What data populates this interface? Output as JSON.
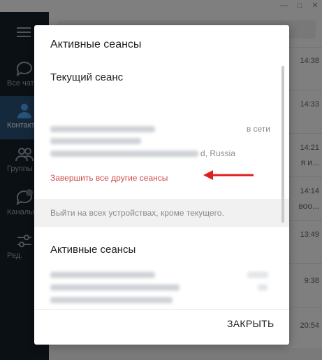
{
  "app": {
    "sidebar": [
      {
        "label": "Все чаты",
        "icon": "chat-bubbles-icon"
      },
      {
        "label": "Контакты",
        "icon": "person-icon"
      },
      {
        "label": "Группы",
        "icon": "group-icon"
      },
      {
        "label": "Каналы",
        "icon": "channel-icon"
      },
      {
        "label": "Ред.",
        "icon": "sliders-icon"
      }
    ],
    "chats": [
      {
        "time": "14:38",
        "snippet": ""
      },
      {
        "time": "14:33",
        "snippet": ""
      },
      {
        "time": "14:21",
        "snippet": "я и..."
      },
      {
        "time": "14:14",
        "snippet": "воо..."
      },
      {
        "time": "13:49",
        "snippet": ""
      },
      {
        "time": "9:38",
        "snippet": ""
      },
      {
        "time": "20:54",
        "snippet": ""
      }
    ]
  },
  "dialog": {
    "title": "Активные сеансы",
    "current": {
      "heading": "Текущий сеанс",
      "status": "в сети",
      "location": "d, Russia",
      "terminate_label": "Завершить все другие сеансы"
    },
    "hint": "Выйти на всех устройствах, кроме текущего.",
    "active_heading": "Активные сеансы",
    "close_label": "ЗАКРЫТЬ"
  },
  "colors": {
    "danger": "#d14e4e",
    "arrow": "#e02020",
    "sidebar_bg": "#17212b",
    "sidebar_active": "#2b5278"
  }
}
